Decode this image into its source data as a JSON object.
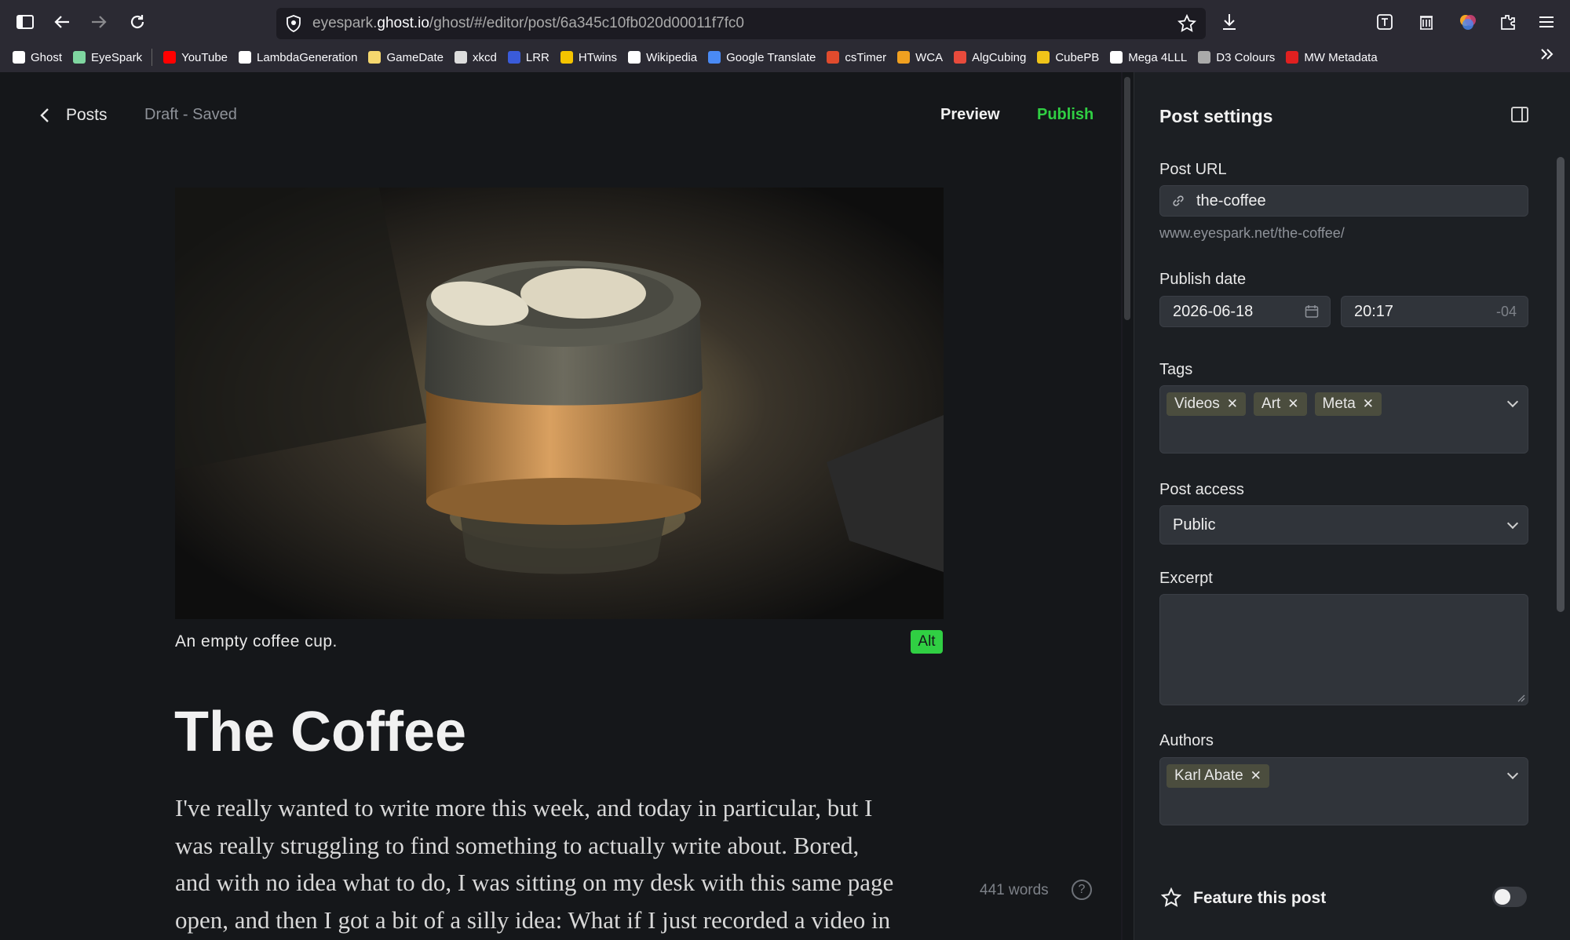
{
  "browser": {
    "url_prefix": "eyespark.",
    "url_domain": "ghost.io",
    "url_path": "/ghost/#/editor/post/6a345c10fb020d00011f7fc0"
  },
  "bookmarks": [
    {
      "label": "Ghost",
      "color": "#ffffff"
    },
    {
      "label": "EyeSpark",
      "color": "#7fd6a0"
    },
    {
      "label": "YouTube",
      "color": "#ff0000"
    },
    {
      "label": "LambdaGeneration",
      "color": "#ffffff"
    },
    {
      "label": "GameDate",
      "color": "#f5d76e"
    },
    {
      "label": "xkcd",
      "color": "#dddddd"
    },
    {
      "label": "LRR",
      "color": "#3a5bd9"
    },
    {
      "label": "HTwins",
      "color": "#f5c400"
    },
    {
      "label": "Wikipedia",
      "color": "#ffffff"
    },
    {
      "label": "Google Translate",
      "color": "#4a8af4"
    },
    {
      "label": "csTimer",
      "color": "#e04b2d"
    },
    {
      "label": "WCA",
      "color": "#f0a020"
    },
    {
      "label": "AlgCubing",
      "color": "#e84b3c"
    },
    {
      "label": "CubePB",
      "color": "#f0c419"
    },
    {
      "label": "Mega 4LLL",
      "color": "#ffffff"
    },
    {
      "label": "D3 Colours",
      "color": "#aaaaaa"
    },
    {
      "label": "MW Metadata",
      "color": "#e02020"
    }
  ],
  "editor": {
    "back_label": "Posts",
    "status": "Draft - Saved",
    "preview_label": "Preview",
    "publish_label": "Publish",
    "image_caption": "An empty coffee cup.",
    "alt_label": "Alt",
    "title": "The Coffee",
    "body_lines": [
      "I've really wanted to write more this week, and today in particular, but I",
      "was really struggling to find something to actually write about. Bored,",
      "and with no idea what to do, I was sitting on my desk with this same page",
      "open, and then I got a bit of a silly idea: What if I just recorded a video in"
    ],
    "word_count": "441 words",
    "help_label": "?"
  },
  "settings": {
    "title": "Post settings",
    "post_url_label": "Post URL",
    "slug": "the-coffee",
    "full_url": "www.eyespark.net/the-coffee/",
    "publish_date_label": "Publish date",
    "date": "2026-06-18",
    "time": "20:17",
    "tz": "-04",
    "tags_label": "Tags",
    "tags": [
      "Videos",
      "Art",
      "Meta"
    ],
    "access_label": "Post access",
    "access_value": "Public",
    "excerpt_label": "Excerpt",
    "authors_label": "Authors",
    "authors": [
      "Karl Abate"
    ],
    "feature_label": "Feature this post",
    "feature_enabled": false
  },
  "colors": {
    "accent": "#30cf43",
    "editor_bg": "#15171a",
    "panel_bg": "#1c1f23"
  }
}
